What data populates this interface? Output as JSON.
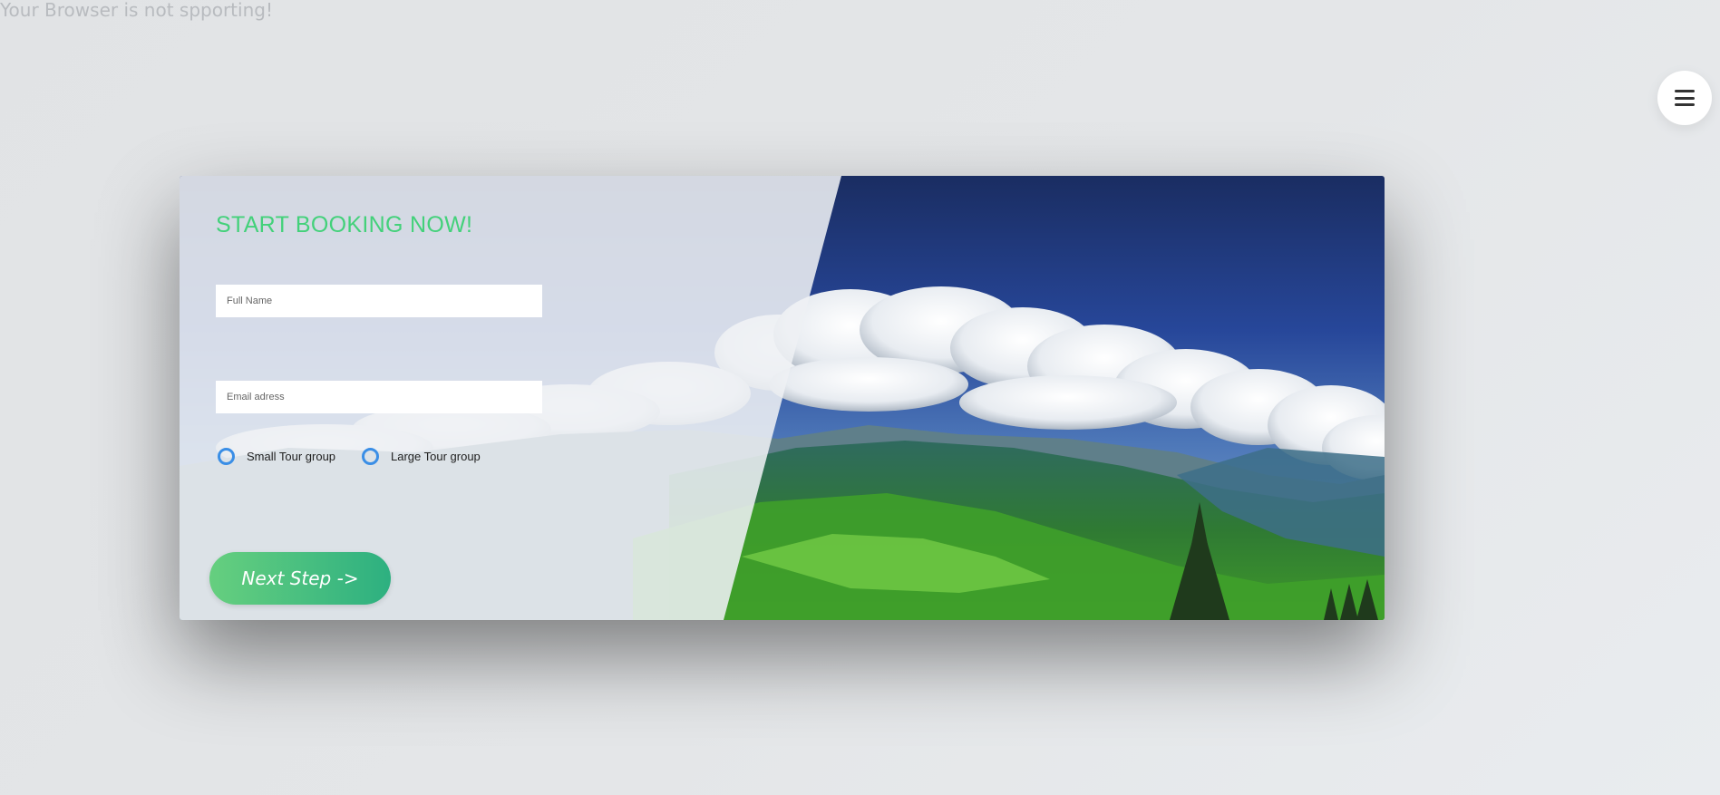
{
  "page": {
    "notice": "Your Browser is not spporting!"
  },
  "menu": {
    "icon": "hamburger-menu-icon"
  },
  "booking": {
    "title": "START BOOKING NOW!",
    "fields": {
      "full_name": {
        "placeholder": "Full Name",
        "value": ""
      },
      "email": {
        "placeholder": "Email adress",
        "value": ""
      }
    },
    "tour_options": [
      {
        "label": "Small Tour group",
        "selected": false
      },
      {
        "label": "Large Tour group",
        "selected": false
      }
    ],
    "next_label": "Next Step ->"
  },
  "colors": {
    "accent": "#43d17a",
    "button_start": "#66cf7f",
    "button_end": "#2db080",
    "radio": "#3a8ee6"
  }
}
